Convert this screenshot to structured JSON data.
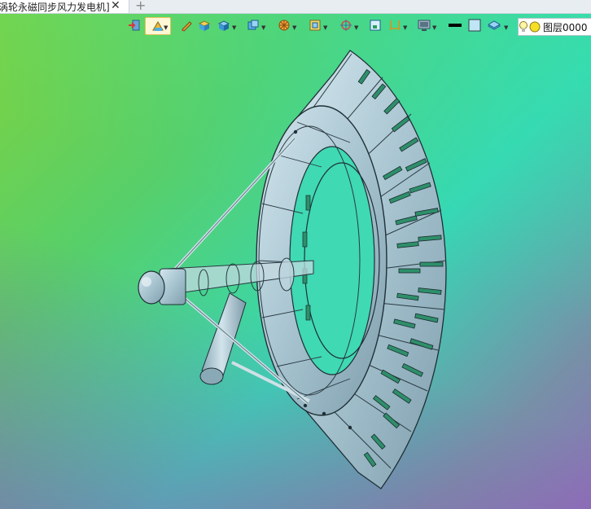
{
  "document_tab": {
    "title": "涡轮永磁同步风力发电机]",
    "close_glyph": "✕",
    "add_glyph": "+"
  },
  "toolbar": {
    "tools": [
      {
        "name": "import-icon"
      },
      {
        "name": "style-palette-icon",
        "active": true,
        "dropdown": true
      },
      {
        "name": "pencil-icon"
      },
      {
        "name": "solid-box-icon"
      },
      {
        "name": "shaded-cube-icon",
        "dropdown": true
      },
      {
        "name": "view-cube-icon",
        "dropdown": true
      },
      {
        "name": "wheel-icon",
        "dropdown": true
      },
      {
        "name": "frame-icon",
        "dropdown": true
      },
      {
        "name": "crosshair-icon",
        "dropdown": true
      },
      {
        "name": "fit-view-icon"
      },
      {
        "name": "dimension-icon",
        "dropdown": true
      },
      {
        "name": "monitor-icon",
        "dropdown": true
      },
      {
        "name": "line-color-icon"
      },
      {
        "name": "fill-color-icon"
      },
      {
        "name": "layers-icon",
        "dropdown": true
      }
    ],
    "layer": {
      "label": "图层0000"
    }
  },
  "colors": {
    "tab_bar": "#e8edf2",
    "model_fill": "#a9c6d2",
    "slot_highlight": "#3ecf88"
  }
}
